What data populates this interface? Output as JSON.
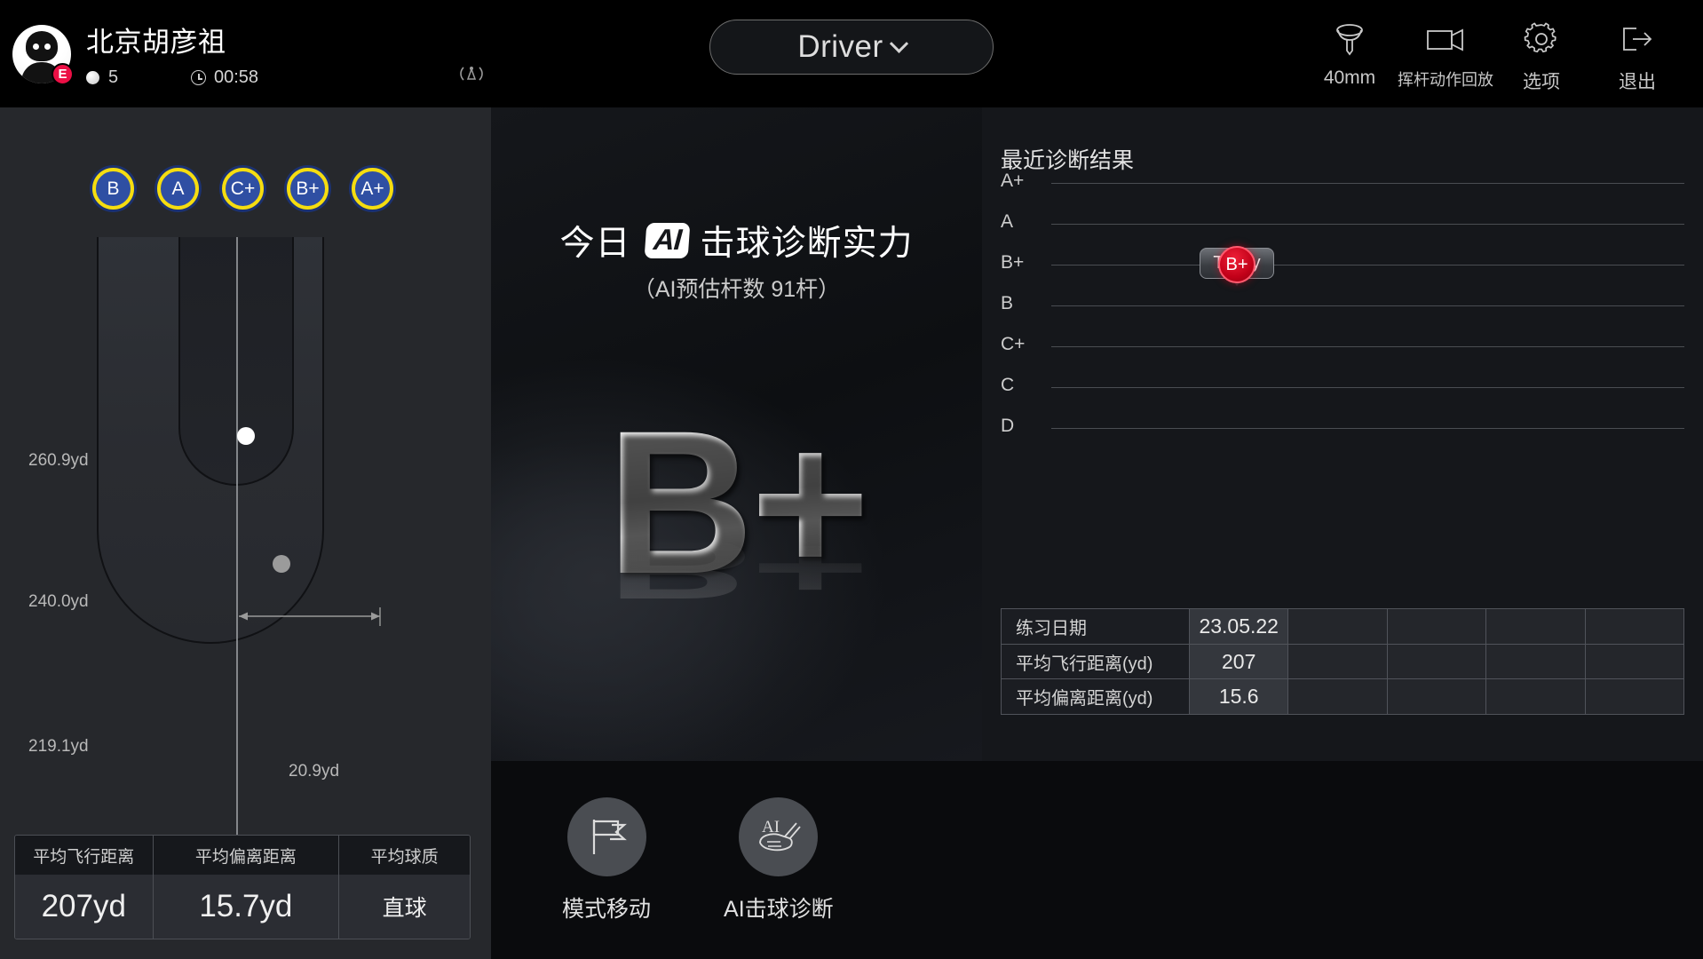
{
  "header": {
    "player_name": "北京胡彦祖",
    "level_badge": "E",
    "ball_count": "5",
    "timer": "00:58",
    "signal_icon": "signal-icon",
    "club": {
      "label": "Driver",
      "chevron": "chevron-down-icon"
    },
    "icons": [
      {
        "name": "tee-height-icon",
        "label": "40mm"
      },
      {
        "name": "swing-replay-icon",
        "label": "挥杆动作回放"
      },
      {
        "name": "settings-gear-icon",
        "label": "选项"
      },
      {
        "name": "exit-icon",
        "label": "退出"
      }
    ]
  },
  "left": {
    "grade_badges": [
      "B",
      "A",
      "C+",
      "B+",
      "A+"
    ],
    "dispersion": {
      "far_label": "260.9yd",
      "mid_label": "240.0yd",
      "near_label": "219.1yd",
      "width_label": "20.9yd"
    },
    "stats": [
      {
        "header": "平均飞行距离",
        "value": "207yd"
      },
      {
        "header": "平均偏离距离",
        "value": "15.7yd"
      },
      {
        "header": "平均球质",
        "value": "直球"
      }
    ]
  },
  "center": {
    "title_prefix": "今日",
    "ai_chip": "AI",
    "title_suffix": "击球诊断实力",
    "subtitle": "（AI预估杆数 91杆）",
    "grade": "B+"
  },
  "right": {
    "title": "最近诊断结果",
    "table_rows": [
      {
        "label": "练习日期",
        "value": "23.05.22"
      },
      {
        "label": "平均飞行距离(yd)",
        "value": "207"
      },
      {
        "label": "平均偏离距离(yd)",
        "value": "15.6"
      }
    ]
  },
  "bottom_buttons": [
    {
      "icon": "flag-icon",
      "label": "模式移动"
    },
    {
      "icon": "ai-club-icon",
      "label": "AI击球诊断"
    }
  ],
  "chart_data": {
    "type": "scatter",
    "title": "最近诊断结果",
    "xlabel": "",
    "ylabel": "",
    "categories": [
      "A+",
      "A",
      "B+",
      "B",
      "C+",
      "C",
      "D"
    ],
    "points": [
      {
        "x": "Today",
        "y": "B+",
        "label": "B+",
        "annotation": "Today"
      }
    ],
    "grid": true,
    "legend": "none",
    "marker_color": "#c10018",
    "gridline_color": "#4a4d52"
  }
}
